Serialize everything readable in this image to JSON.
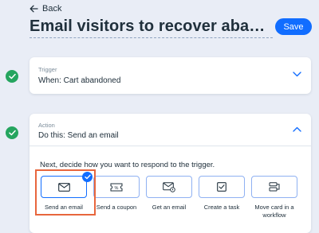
{
  "header": {
    "back_label": "Back",
    "title": "Email visitors to recover abandoned carts",
    "save_label": "Save"
  },
  "trigger_card": {
    "kicker": "Trigger",
    "summary": "When: Cart abandoned"
  },
  "action_card": {
    "kicker": "Action",
    "summary": "Do this: Send an email",
    "prompt": "Next, decide how you want to respond to the trigger.",
    "options": [
      {
        "label": "Send an email",
        "icon": "envelope-icon",
        "selected": true
      },
      {
        "label": "Send a coupon",
        "icon": "coupon-icon",
        "selected": false
      },
      {
        "label": "Get an email",
        "icon": "envelope-bell-icon",
        "selected": false
      },
      {
        "label": "Create a task",
        "icon": "task-checkbox-icon",
        "selected": false
      },
      {
        "label": "Move card in a workflow",
        "icon": "workflow-card-icon",
        "selected": false
      }
    ]
  },
  "colors": {
    "background": "#e9edf6",
    "accent": "#116dff",
    "success": "#25a55f",
    "highlight": "#e8663d"
  }
}
